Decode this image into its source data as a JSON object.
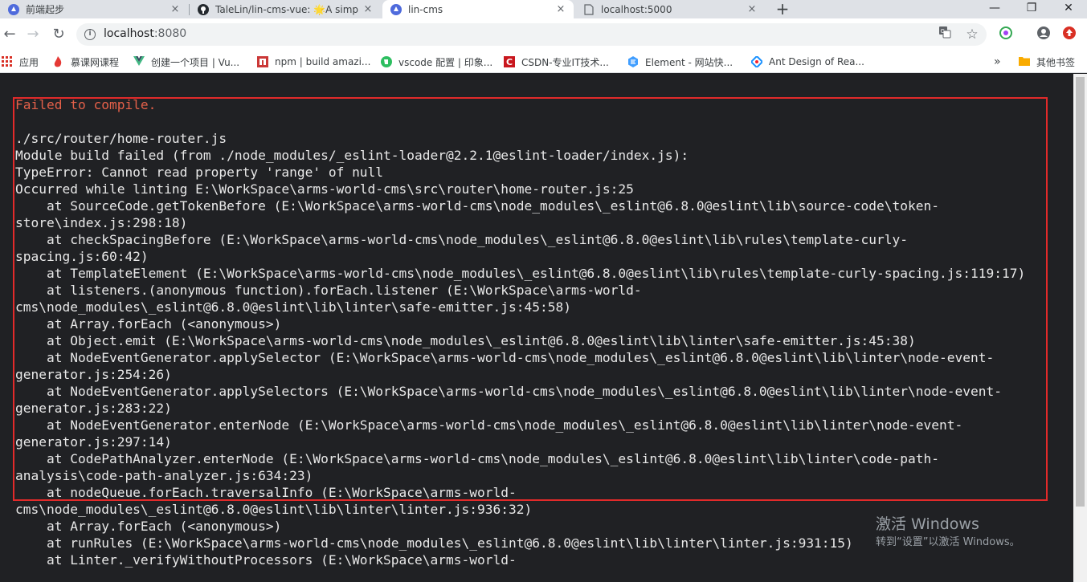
{
  "tabs": [
    {
      "title": "前端起步",
      "close": "×",
      "favicon": "chrome-icon"
    },
    {
      "title": "TaleLin/lin-cms-vue: 🌟A simp",
      "close": "×",
      "favicon": "github-icon"
    },
    {
      "title": "lin-cms",
      "close": "×",
      "favicon": "chrome-icon",
      "active": true
    },
    {
      "title": "localhost:5000",
      "close": "×",
      "favicon": "page-icon"
    }
  ],
  "new_tab": "+",
  "window_controls": {
    "minimize": "—",
    "maximize": "❐",
    "close": "✕"
  },
  "toolbar": {
    "back": "←",
    "forward": "→",
    "reload": "↻",
    "url_host": "localhost",
    "url_port": ":8080",
    "info": "i"
  },
  "bookmarks": [
    {
      "label": "应用",
      "color": "#d93025"
    },
    {
      "label": "慕课网课程",
      "color": "#e53935"
    },
    {
      "label": "创建一个项目 | Vu...",
      "color": "#41b883"
    },
    {
      "label": "npm | build amazi...",
      "color": "#cb3837"
    },
    {
      "label": "vscode 配置 | 印象...",
      "color": "#2dbe60"
    },
    {
      "label": "CSDN-专业IT技术...",
      "color": "#c9171e"
    },
    {
      "label": "Element - 网站快...",
      "color": "#409eff"
    },
    {
      "label": "Ant Design of Rea...",
      "color": "#1890ff"
    }
  ],
  "bookmarks_more": "»",
  "other_bookmarks": "其他书签",
  "error": {
    "title": "Failed to compile.",
    "lines": [
      "",
      "./src/router/home-router.js",
      "Module build failed (from ./node_modules/_eslint-loader@2.2.1@eslint-loader/index.js):",
      "TypeError: Cannot read property 'range' of null",
      "Occurred while linting E:\\WorkSpace\\arms-world-cms\\src\\router\\home-router.js:25",
      "    at SourceCode.getTokenBefore (E:\\WorkSpace\\arms-world-cms\\node_modules\\_eslint@6.8.0@eslint\\lib\\source-code\\token-",
      "store\\index.js:298:18)",
      "    at checkSpacingBefore (E:\\WorkSpace\\arms-world-cms\\node_modules\\_eslint@6.8.0@eslint\\lib\\rules\\template-curly-",
      "spacing.js:60:42)",
      "    at TemplateElement (E:\\WorkSpace\\arms-world-cms\\node_modules\\_eslint@6.8.0@eslint\\lib\\rules\\template-curly-spacing.js:119:17)",
      "    at listeners.(anonymous function).forEach.listener (E:\\WorkSpace\\arms-world-",
      "cms\\node_modules\\_eslint@6.8.0@eslint\\lib\\linter\\safe-emitter.js:45:58)",
      "    at Array.forEach (<anonymous>)",
      "    at Object.emit (E:\\WorkSpace\\arms-world-cms\\node_modules\\_eslint@6.8.0@eslint\\lib\\linter\\safe-emitter.js:45:38)",
      "    at NodeEventGenerator.applySelector (E:\\WorkSpace\\arms-world-cms\\node_modules\\_eslint@6.8.0@eslint\\lib\\linter\\node-event-",
      "generator.js:254:26)",
      "    at NodeEventGenerator.applySelectors (E:\\WorkSpace\\arms-world-cms\\node_modules\\_eslint@6.8.0@eslint\\lib\\linter\\node-event-",
      "generator.js:283:22)",
      "    at NodeEventGenerator.enterNode (E:\\WorkSpace\\arms-world-cms\\node_modules\\_eslint@6.8.0@eslint\\lib\\linter\\node-event-",
      "generator.js:297:14)",
      "    at CodePathAnalyzer.enterNode (E:\\WorkSpace\\arms-world-cms\\node_modules\\_eslint@6.8.0@eslint\\lib\\linter\\code-path-",
      "analysis\\code-path-analyzer.js:634:23)",
      "    at nodeQueue.forEach.traversalInfo (E:\\WorkSpace\\arms-world-",
      "cms\\node_modules\\_eslint@6.8.0@eslint\\lib\\linter\\linter.js:936:32)",
      "    at Array.forEach (<anonymous>)",
      "    at runRules (E:\\WorkSpace\\arms-world-cms\\node_modules\\_eslint@6.8.0@eslint\\lib\\linter\\linter.js:931:15)",
      "    at Linter._verifyWithoutProcessors (E:\\WorkSpace\\arms-world-"
    ]
  },
  "watermark": {
    "line1": "激活 Windows",
    "line2": "转到“设置”以激活 Windows。"
  }
}
